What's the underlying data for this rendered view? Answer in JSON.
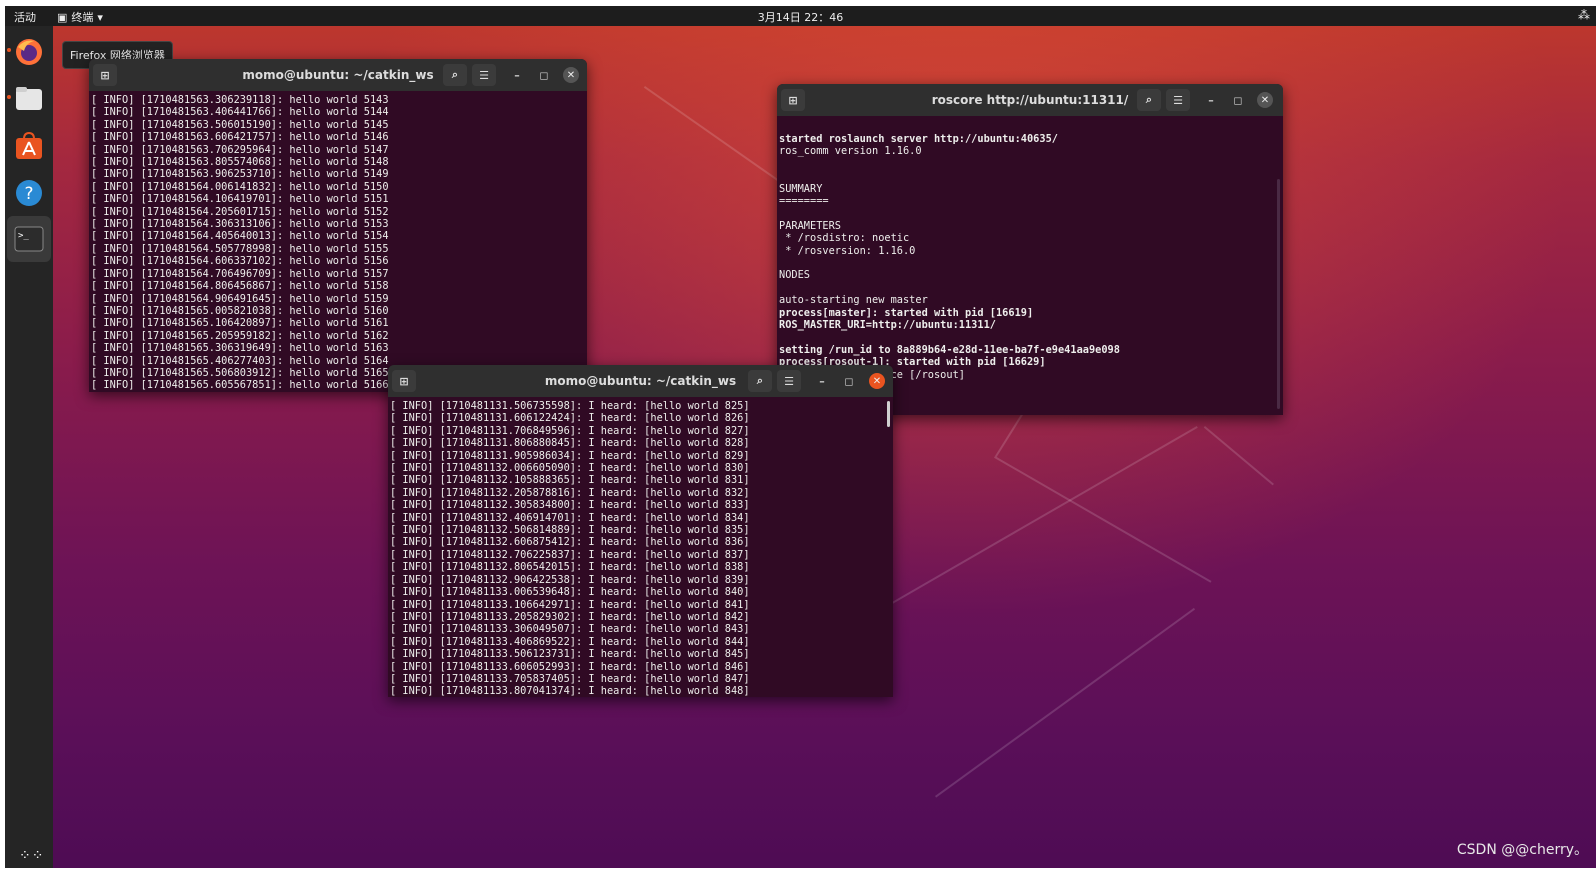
{
  "topbar": {
    "activities": "活动",
    "app_menu": "终端",
    "clock": "3月14日 22：46"
  },
  "dock": {
    "tooltip": "Firefox 网络浏览器",
    "items": [
      "firefox-icon",
      "files-icon",
      "software-icon",
      "help-icon",
      "terminal-icon"
    ]
  },
  "windows": {
    "talker": {
      "title": "momo@ubuntu: ~/catkin_ws",
      "lines": [
        "[ INFO] [1710481563.306239118]: hello world 5143",
        "[ INFO] [1710481563.406441766]: hello world 5144",
        "[ INFO] [1710481563.506015190]: hello world 5145",
        "[ INFO] [1710481563.606421757]: hello world 5146",
        "[ INFO] [1710481563.706295964]: hello world 5147",
        "[ INFO] [1710481563.805574068]: hello world 5148",
        "[ INFO] [1710481563.906253710]: hello world 5149",
        "[ INFO] [1710481564.006141832]: hello world 5150",
        "[ INFO] [1710481564.106419701]: hello world 5151",
        "[ INFO] [1710481564.205601715]: hello world 5152",
        "[ INFO] [1710481564.306313106]: hello world 5153",
        "[ INFO] [1710481564.405640013]: hello world 5154",
        "[ INFO] [1710481564.505778998]: hello world 5155",
        "[ INFO] [1710481564.606337102]: hello world 5156",
        "[ INFO] [1710481564.706496709]: hello world 5157",
        "[ INFO] [1710481564.806456867]: hello world 5158",
        "[ INFO] [1710481564.906491645]: hello world 5159",
        "[ INFO] [1710481565.005821038]: hello world 5160",
        "[ INFO] [1710481565.106420897]: hello world 5161",
        "[ INFO] [1710481565.205959182]: hello world 5162",
        "[ INFO] [1710481565.306319649]: hello world 5163",
        "[ INFO] [1710481565.406277403]: hello world 5164",
        "[ INFO] [1710481565.506803912]: hello world 5165",
        "[ INFO] [1710481565.605567851]: hello world 5166"
      ]
    },
    "roscore": {
      "title": "roscore http://ubuntu:11311/",
      "lines": [
        {
          "text": "started roslaunch server http://ubuntu:40635/",
          "bold": true
        },
        {
          "text": "ros_comm version 1.16.0",
          "bold": false
        },
        {
          "text": "",
          "bold": false
        },
        {
          "text": "",
          "bold": false
        },
        {
          "text": "SUMMARY",
          "bold": false
        },
        {
          "text": "========",
          "bold": false
        },
        {
          "text": "",
          "bold": false
        },
        {
          "text": "PARAMETERS",
          "bold": false
        },
        {
          "text": " * /rosdistro: noetic",
          "bold": false
        },
        {
          "text": " * /rosversion: 1.16.0",
          "bold": false
        },
        {
          "text": "",
          "bold": false
        },
        {
          "text": "NODES",
          "bold": false
        },
        {
          "text": "",
          "bold": false
        },
        {
          "text": "auto-starting new master",
          "bold": false
        },
        {
          "text": "process[master]: started with pid [16619]",
          "bold": true
        },
        {
          "text": "ROS_MASTER_URI=http://ubuntu:11311/",
          "bold": true
        },
        {
          "text": "",
          "bold": false
        },
        {
          "text": "setting /run_id to 8a889b64-e28d-11ee-ba7f-e9e41aa9e098",
          "bold": true
        },
        {
          "text": "process[rosout-1]: started with pid [16629]",
          "bold": true
        },
        {
          "text": "started core service [/rosout]",
          "bold": false
        }
      ]
    },
    "listener": {
      "title": "momo@ubuntu: ~/catkin_ws",
      "lines": [
        "[ INFO] [1710481131.506735598]: I heard: [hello world 825]",
        "[ INFO] [1710481131.606122424]: I heard: [hello world 826]",
        "[ INFO] [1710481131.706849596]: I heard: [hello world 827]",
        "[ INFO] [1710481131.806880845]: I heard: [hello world 828]",
        "[ INFO] [1710481131.905986034]: I heard: [hello world 829]",
        "[ INFO] [1710481132.006605090]: I heard: [hello world 830]",
        "[ INFO] [1710481132.105888365]: I heard: [hello world 831]",
        "[ INFO] [1710481132.205878816]: I heard: [hello world 832]",
        "[ INFO] [1710481132.305834800]: I heard: [hello world 833]",
        "[ INFO] [1710481132.406914701]: I heard: [hello world 834]",
        "[ INFO] [1710481132.506814889]: I heard: [hello world 835]",
        "[ INFO] [1710481132.606875412]: I heard: [hello world 836]",
        "[ INFO] [1710481132.706225837]: I heard: [hello world 837]",
        "[ INFO] [1710481132.806542015]: I heard: [hello world 838]",
        "[ INFO] [1710481132.906422538]: I heard: [hello world 839]",
        "[ INFO] [1710481133.006539648]: I heard: [hello world 840]",
        "[ INFO] [1710481133.106642971]: I heard: [hello world 841]",
        "[ INFO] [1710481133.205829302]: I heard: [hello world 842]",
        "[ INFO] [1710481133.306049507]: I heard: [hello world 843]",
        "[ INFO] [1710481133.406869522]: I heard: [hello world 844]",
        "[ INFO] [1710481133.506123731]: I heard: [hello world 845]",
        "[ INFO] [1710481133.606052993]: I heard: [hello world 846]",
        "[ INFO] [1710481133.705837405]: I heard: [hello world 847]",
        "[ INFO] [1710481133.807041374]: I heard: [hello world 848]"
      ]
    }
  },
  "watermark": "CSDN @@cherry。",
  "colors": {
    "accent": "#e95420",
    "terminal_bg": "#300a24",
    "titlebar": "#2f2f2f"
  }
}
